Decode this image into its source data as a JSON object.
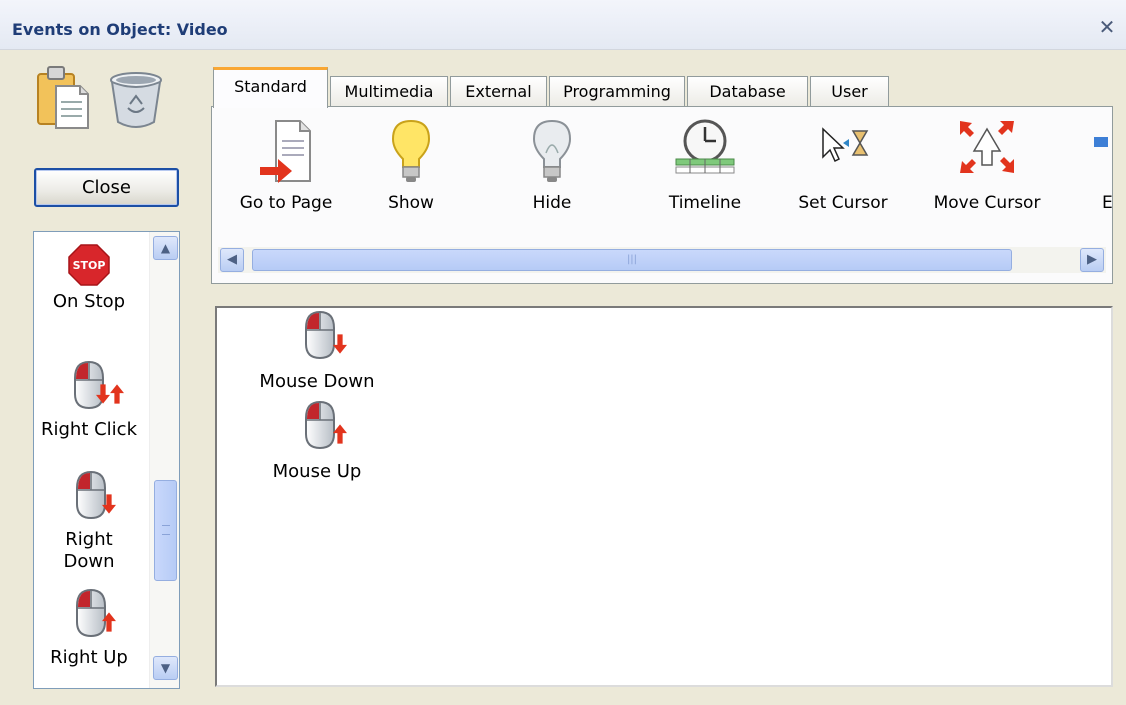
{
  "window": {
    "title": "Events on Object: Video",
    "close_glyph": "✕"
  },
  "toolbar": {
    "paste_icon": "clipboard-icon",
    "delete_icon": "recycle-bin-icon",
    "close_label": "Close"
  },
  "events_list": {
    "items": [
      {
        "label": "On Stop",
        "icon": "stop-sign-icon"
      },
      {
        "label": "Right Click",
        "icon": "mouse-right-click-icon"
      },
      {
        "label": "Right Down",
        "label_lines": [
          "Right",
          "Down"
        ],
        "icon": "mouse-right-down-icon"
      },
      {
        "label": "Right Up",
        "icon": "mouse-right-up-icon"
      }
    ]
  },
  "tabs": [
    {
      "label": "Standard",
      "active": true
    },
    {
      "label": "Multimedia"
    },
    {
      "label": "External"
    },
    {
      "label": "Programming"
    },
    {
      "label": "Database"
    },
    {
      "label": "User"
    }
  ],
  "actions": [
    {
      "label": "Go to Page",
      "icon": "go-to-page-icon"
    },
    {
      "label": "Show",
      "icon": "lightbulb-on-icon"
    },
    {
      "label": "Hide",
      "icon": "lightbulb-off-icon"
    },
    {
      "label": "Timeline",
      "icon": "timeline-clock-icon"
    },
    {
      "label": "Set Cursor",
      "icon": "set-cursor-icon"
    },
    {
      "label": "Move Cursor",
      "icon": "move-cursor-icon"
    },
    {
      "label": "E",
      "icon": "partial-action-icon"
    }
  ],
  "canvas": {
    "items": [
      {
        "label": "Mouse Down",
        "icon": "mouse-down-icon"
      },
      {
        "label": "Mouse Up",
        "icon": "mouse-up-icon"
      }
    ]
  },
  "colors": {
    "title": "#1f3d77",
    "active_tab_accent": "#f9a733",
    "arrow_red": "#e2341d"
  }
}
